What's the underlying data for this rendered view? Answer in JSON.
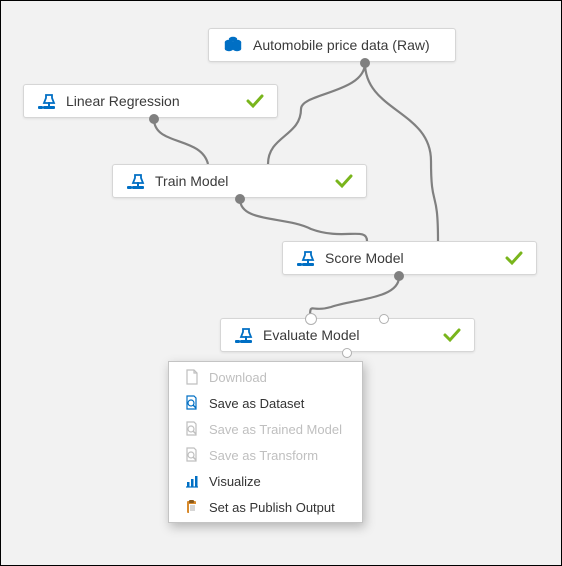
{
  "colors": {
    "blue": "#006FC4",
    "green": "#79B51C",
    "gray": "#808080",
    "light_gray": "#BFBFBF",
    "orange": "#D88A2C"
  },
  "nodes": {
    "dataset": {
      "label": "Automobile price data (Raw)"
    },
    "linear": {
      "label": "Linear Regression"
    },
    "train": {
      "label": "Train Model"
    },
    "score": {
      "label": "Score Model"
    },
    "evaluate": {
      "label": "Evaluate Model"
    }
  },
  "context_menu": {
    "items": [
      {
        "key": "download",
        "label": "Download",
        "icon": "document-icon",
        "enabled": false
      },
      {
        "key": "save_dataset",
        "label": "Save as Dataset",
        "icon": "magnify-doc-icon",
        "enabled": true
      },
      {
        "key": "save_trained_model",
        "label": "Save as Trained Model",
        "icon": "magnify-doc-icon",
        "enabled": false
      },
      {
        "key": "save_transform",
        "label": "Save as Transform",
        "icon": "magnify-doc-icon",
        "enabled": false
      },
      {
        "key": "visualize",
        "label": "Visualize",
        "icon": "chart-icon",
        "enabled": true
      },
      {
        "key": "set_publish_output",
        "label": "Set as Publish Output",
        "icon": "clipboard-icon",
        "enabled": true
      }
    ]
  }
}
